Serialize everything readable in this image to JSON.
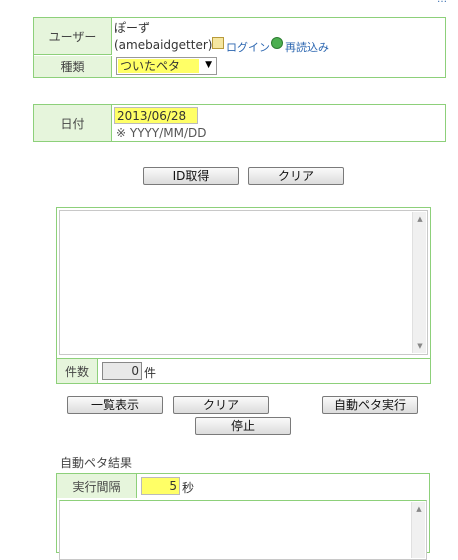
{
  "user": {
    "label": "ユーザー",
    "name": "ぽーず",
    "id": "(amebaidgetter)",
    "login": "ログイン",
    "reload": "再読込み"
  },
  "kind": {
    "label": "種類",
    "selected": "ついたペタ"
  },
  "date": {
    "label": "日付",
    "value": "2013/06/28",
    "hint": "※ YYYY/MM/DD"
  },
  "buttons": {
    "get_id": "ID取得",
    "clear": "クリア",
    "list": "一覧表示",
    "clear2": "クリア",
    "auto_peta": "自動ペタ実行",
    "stop": "停止"
  },
  "count": {
    "label": "件数",
    "value": "0",
    "unit": "件"
  },
  "result": {
    "heading": "自動ペタ結果",
    "interval_label": "実行間隔",
    "interval_value": "5",
    "interval_unit": "秒"
  },
  "colors": {
    "border": "#8dd07a",
    "label_bg": "#e6f5dc",
    "highlight": "#ffff66"
  }
}
